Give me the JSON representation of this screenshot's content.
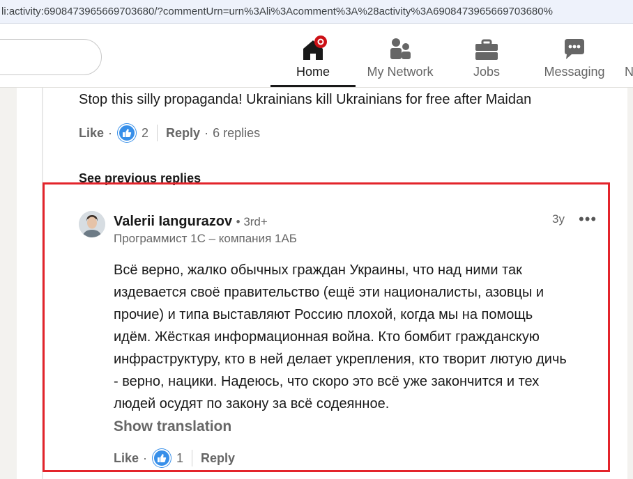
{
  "browser": {
    "url": "li:activity:6908473965669703680/?commentUrn=urn%3Ali%3Acomment%3A%28activity%3A6908473965669703680%"
  },
  "nav": {
    "items": [
      {
        "label": "Home",
        "icon": "home-icon",
        "active": true
      },
      {
        "label": "My Network",
        "icon": "network-icon",
        "active": false
      },
      {
        "label": "Jobs",
        "icon": "briefcase-icon",
        "active": false
      },
      {
        "label": "Messaging",
        "icon": "messaging-icon",
        "active": false
      },
      {
        "label": "N",
        "icon": "notifications-icon",
        "active": false
      }
    ]
  },
  "parent_comment": {
    "text": "Stop this silly propaganda! Ukrainians kill Ukrainians for free after Maidan",
    "like_label": "Like",
    "reactions": "2",
    "reply_label": "Reply",
    "replies": "6 replies"
  },
  "see_previous": "See previous replies",
  "reply": {
    "author": "Valerii Iangurazov",
    "degree": "• 3rd+",
    "headline": "Программист 1С – компания 1АБ",
    "time": "3y",
    "more": "•••",
    "body_lines": [
      "Всё верно, жалко обычных граждан Украины, что над ними так",
      "издевается своё правительство (ещё эти националисты, азовцы и",
      "прочие) и типа выставляют Россию плохой, когда мы на помощь",
      "идём. Жёсткая информационная война. Кто бомбит гражданскую",
      "инфраструктуру, кто в ней делает укрепления, кто творит лютую дичь",
      "- верно, нацики. Надеюсь, что скоро это всё уже закончится и тех",
      "людей осудят по закону за всё содеянное."
    ],
    "show_translation": "Show translation",
    "like_label": "Like",
    "reactions": "1",
    "reply_label": "Reply"
  },
  "colors": {
    "highlight": "#e3242b",
    "like_blue": "#378fe9",
    "notification_red": "#cc1016"
  }
}
